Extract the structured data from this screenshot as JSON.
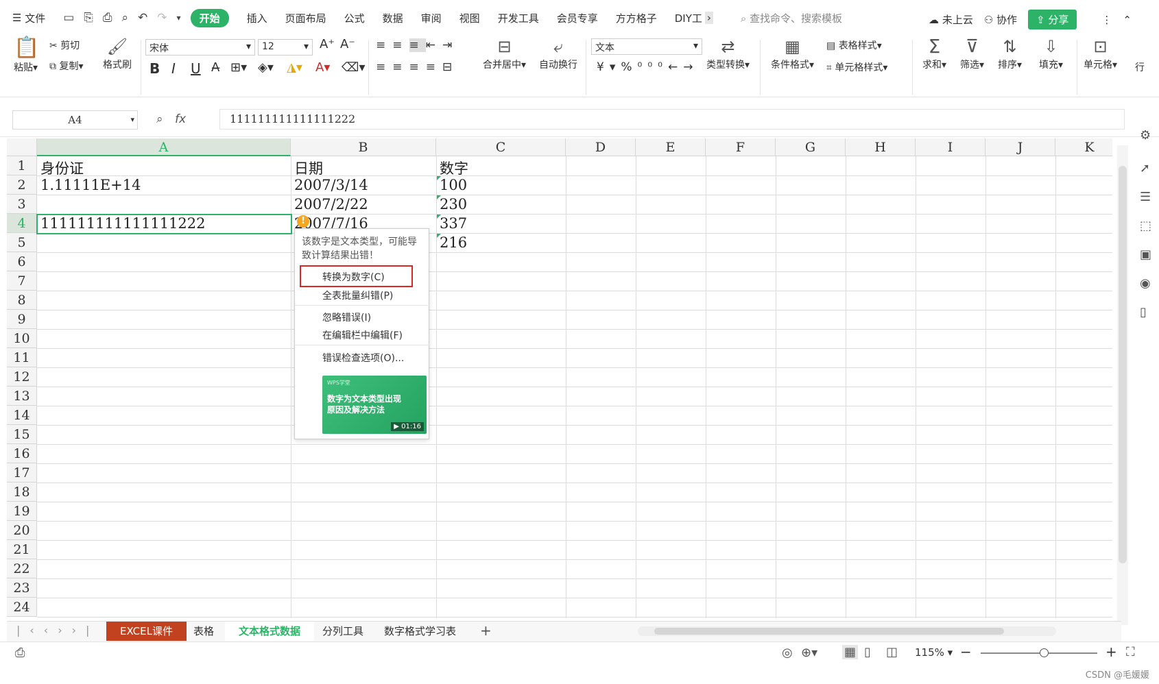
{
  "menu": {
    "file": "文件",
    "tabs": [
      "开始",
      "插入",
      "页面布局",
      "公式",
      "数据",
      "审阅",
      "视图",
      "开发工具",
      "会员专享",
      "方方格子",
      "DIY工"
    ],
    "search": "查找命令、搜索模板",
    "cloud": "未上云",
    "collab": "协作",
    "share": "分享"
  },
  "ribbon": {
    "paste": "粘贴",
    "cut": "剪切",
    "copy": "复制",
    "format_painter": "格式刷",
    "font": "宋体",
    "size": "12",
    "merge": "合并居中",
    "wrap": "自动换行",
    "num_format": "文本",
    "convert": "类型转换",
    "cond_format": "条件格式",
    "table_style": "表格样式",
    "cell_style": "单元格样式",
    "sum": "求和",
    "filter": "筛选",
    "sort": "排序",
    "fill": "填充",
    "cell": "单元格",
    "row": "行"
  },
  "formula": {
    "namebox": "A4",
    "fx": "fx",
    "value": "111111111111111222"
  },
  "columns": [
    "A",
    "B",
    "C",
    "D",
    "E",
    "F",
    "G",
    "H",
    "I",
    "J",
    "K"
  ],
  "rows": [
    "1",
    "2",
    "3",
    "4",
    "5",
    "6",
    "7",
    "8",
    "9",
    "10",
    "11",
    "12",
    "13",
    "14",
    "15",
    "16",
    "17",
    "18",
    "19",
    "20",
    "21",
    "22",
    "23",
    "24"
  ],
  "cells": {
    "a1": "身份证",
    "b1": "日期",
    "c1": "数字",
    "a2": "1.11111E+14",
    "b2": "2007/3/14",
    "c2": "100",
    "b3": "2007/2/22",
    "c3": "230",
    "a4": "111111111111111222",
    "b4": "2007/7/16",
    "c4": "337",
    "c5": "216"
  },
  "popup": {
    "msg": "该数字是文本类型，可能导致计算结果出错！",
    "convert": "转换为数字(C)",
    "batch": "全表批量纠错(P)",
    "ignore": "忽略错误(I)",
    "edit": "在编辑栏中编辑(F)",
    "options": "错误检查选项(O)...",
    "thumb_brand": "WPS学堂",
    "thumb_title": "数字为文本类型出现原因及解决方法",
    "thumb_time": "01:16"
  },
  "sheets": [
    "EXCEL课件",
    "表格",
    "文本格式数据",
    "分列工具",
    "数字格式学习表"
  ],
  "status": {
    "zoom": "115%"
  },
  "watermark": "CSDN @毛媛媛"
}
